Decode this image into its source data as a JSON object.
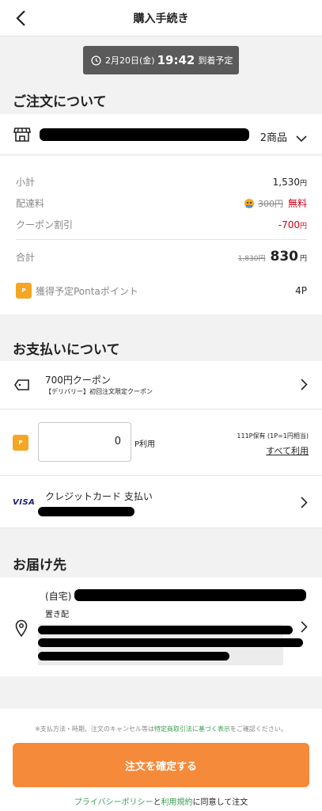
{
  "header": {
    "title": "購入手続き"
  },
  "eta": {
    "date": "2月20日(金)",
    "time": "19:42",
    "label": "到着予定"
  },
  "order": {
    "section_title": "ご注文について",
    "items_count": "2商品",
    "summary": {
      "subtotal_label": "小計",
      "subtotal_value": "1,530",
      "shipping_label": "配達料",
      "shipping_original": "300円",
      "shipping_value": "無料",
      "coupon_label": "クーポン割引",
      "coupon_value": "-700",
      "total_label": "合計",
      "total_original": "1,830円",
      "total_value": "830",
      "yen": "円"
    },
    "points_label": "獲得予定Pontaポイント",
    "points_value": "4P"
  },
  "payment": {
    "section_title": "お支払いについて",
    "coupon_title": "700円クーポン",
    "coupon_sub": "【デリバリー】初回注文限定クーポン",
    "points_input_value": "0",
    "points_unit": "P利用",
    "points_held": "111P保有 (1P=1円相当)",
    "use_all": "すべて利用",
    "card_brand": "VISA",
    "card_label": "クレジットカード 支払い"
  },
  "delivery": {
    "section_title": "お届け先",
    "address_type": "(自宅)",
    "drop_method": "置き配"
  },
  "footer": {
    "note_prefix": "※支払方法・時期、注文のキャンセル等は",
    "note_link": "特定商取引法に基づく表示",
    "note_suffix": "をご確認ください。",
    "confirm_button": "注文を確定する",
    "privacy_link": "プライバシーポリシー",
    "and_text": "と",
    "terms_link": "利用規約",
    "agree_suffix": "に同意して注文"
  },
  "colors": {
    "accent": "#f58a3a",
    "link": "#3a9c52",
    "discount": "#d0021b"
  },
  "icons": [
    "back-arrow-icon",
    "clock-icon",
    "store-icon",
    "chevron-down-icon",
    "ponta-icon",
    "coupon-tag-icon",
    "visa-icon",
    "chevron-right-icon",
    "location-pin-icon"
  ]
}
